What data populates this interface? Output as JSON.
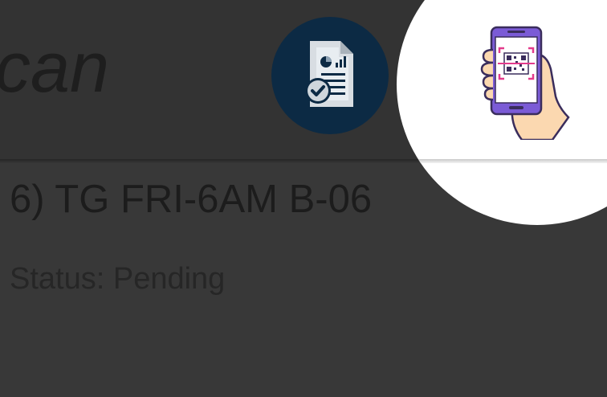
{
  "app_bar": {
    "title": "can",
    "report_icon": "report-document-check-icon",
    "scan_icon": "phone-qr-scan-icon"
  },
  "list": {
    "items": [
      {
        "title": "6) TG FRI-6AM B-06",
        "status": "Status: Pending"
      }
    ]
  },
  "colors": {
    "background": "#383838",
    "report_circle": "#0c2a44",
    "phone_accent": "#7b5bd6",
    "scan_frame": "#e33b8c",
    "hand": "#fbd8b0"
  }
}
